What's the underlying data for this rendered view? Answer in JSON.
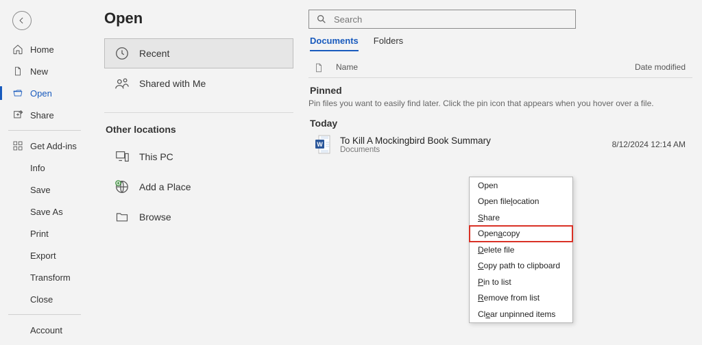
{
  "nav": {
    "home": "Home",
    "new": "New",
    "open": "Open",
    "share": "Share",
    "getaddins": "Get Add-ins",
    "info": "Info",
    "save": "Save",
    "saveas": "Save As",
    "print": "Print",
    "export": "Export",
    "transform": "Transform",
    "close": "Close",
    "account": "Account"
  },
  "mid": {
    "title": "Open",
    "recent": "Recent",
    "shared": "Shared with Me",
    "otherloc": "Other locations",
    "thispc": "This PC",
    "addplace": "Add a Place",
    "browse": "Browse"
  },
  "right": {
    "search_placeholder": "Search",
    "tab_docs": "Documents",
    "tab_folders": "Folders",
    "col_name": "Name",
    "col_date": "Date modified",
    "pinned": "Pinned",
    "pinned_hint": "Pin files you want to easily find later. Click the pin icon that appears when you hover over a file.",
    "today": "Today",
    "file": {
      "name": "To Kill A Mockingbird Book Summary",
      "loc": "Documents",
      "date": "8/12/2024 12:14 AM"
    }
  },
  "ctx": {
    "open": "Open",
    "openloc_pre": "Open file ",
    "openloc_u": "l",
    "openloc_post": "ocation",
    "share_u": "S",
    "share_post": "hare",
    "opencopy_pre": "Open ",
    "opencopy_u": "a",
    "opencopy_post": " copy",
    "delete_u": "D",
    "delete_post": "elete file",
    "copypath_u": "C",
    "copypath_post": "opy path to clipboard",
    "pin_u": "P",
    "pin_post": "in to list",
    "remove_u": "R",
    "remove_post": "emove from list",
    "clear_pre": "Cl",
    "clear_u": "e",
    "clear_post": "ar unpinned items"
  }
}
